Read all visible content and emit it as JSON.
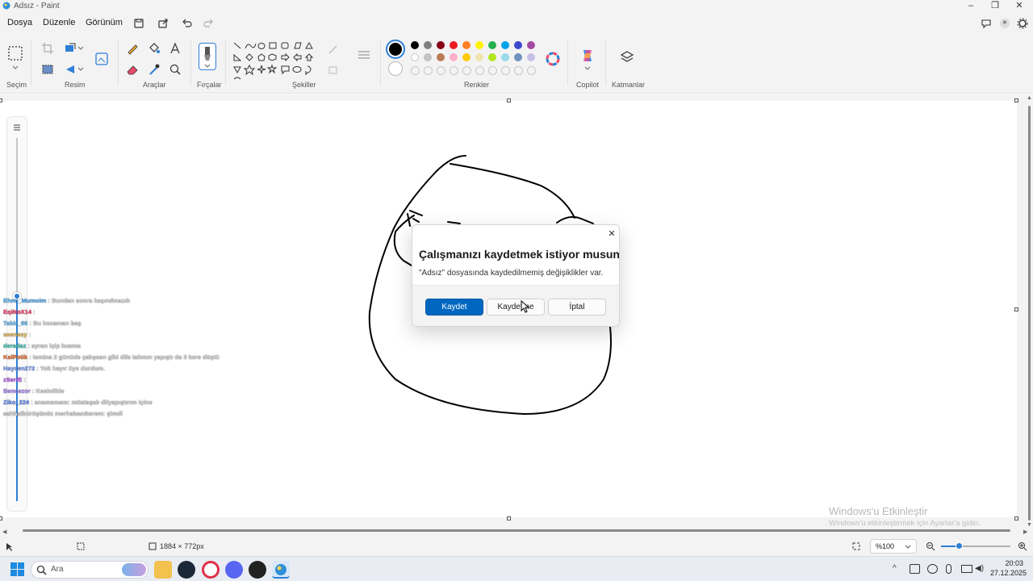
{
  "window": {
    "title": "Adsız - Paint"
  },
  "menu": {
    "file": "Dosya",
    "edit": "Düzenle",
    "view": "Görünüm"
  },
  "ribbon": {
    "groups": {
      "selection": "Seçim",
      "image": "Resim",
      "tools": "Araçlar",
      "brushes": "Fırçalar",
      "shapes": "Şekiller",
      "colors": "Renkler",
      "copilot": "Copilot",
      "layers": "Katmanlar"
    },
    "colors_row1": [
      "#000000",
      "#7f7f7f",
      "#880015",
      "#ed1c24",
      "#ff7f27",
      "#fff200",
      "#22b14c",
      "#00a2e8",
      "#3f48cc",
      "#a349a4"
    ],
    "colors_row2": [
      "#ffffff",
      "#c3c3c3",
      "#b97a57",
      "#ffaec9",
      "#ffc90e",
      "#efe4b0",
      "#b5e61d",
      "#99d9ea",
      "#7092be",
      "#c8bfe7"
    ],
    "primary_color": "#000000",
    "secondary_color": "#ffffff"
  },
  "dialog": {
    "title": "Çalışmanızı kaydetmek istiyor musunuz?",
    "message": "\"Adsız\" dosyasında kaydedilmemiş değişiklikler var.",
    "save_label": "Kaydet",
    "dont_save_label": "Kaydetme",
    "cancel_label": "İptal"
  },
  "chat": [
    {
      "user": "Ehmi_Mumoim",
      "user_color": "#4fb3ff",
      "msg": ": Bundan sonra kaçınılmazdı"
    },
    {
      "user": "EqiNoX14",
      "user_color": "#ff3b6b",
      "msg": ":"
    },
    {
      "user": "Tabir_66",
      "user_color": "#6bc4ff",
      "msg": ": Bu kocaman baş"
    },
    {
      "user": "seenesy",
      "user_color": "#f0c050",
      "msg": ":"
    },
    {
      "user": "deradaz",
      "user_color": "#40d0c0",
      "msg": ": ayran içip kusma"
    },
    {
      "user": "KalPotik",
      "user_color": "#f07030",
      "msg": ": ismina 2 günüde çalışsan gibi dile tahmın yapıştı da 3 kere düştü"
    },
    {
      "user": "Haysen272",
      "user_color": "#7aa0ff",
      "msg": ": Yok hayır üye durdum."
    },
    {
      "user": "zSerfE",
      "user_color": "#c060ff",
      "msg": ":"
    },
    {
      "user": "Bencezor",
      "user_color": "#b08aff",
      "msg": ": Kesinlikle"
    },
    {
      "user": "Ziko_224",
      "user_color": "#6090ff",
      "msg": ": anamamam: müstaşalı dilyapıştırım içine"
    },
    {
      "user": "",
      "user_color": "#ffffff",
      "msg": "aahhalbürüşünüz merhabacıkerem: şimdi"
    }
  ],
  "status": {
    "canvas_size": "1884 × 772px",
    "zoom": "%100",
    "zoom_level": 0.25
  },
  "watermark": {
    "title": "Windows'u Etkinleştir",
    "subtitle": "Windows'u etkinleştirmek için Ayarlar'a gidin."
  },
  "taskbar": {
    "search_placeholder": "Ara",
    "time": "20:03",
    "date": "27.12.2025"
  }
}
